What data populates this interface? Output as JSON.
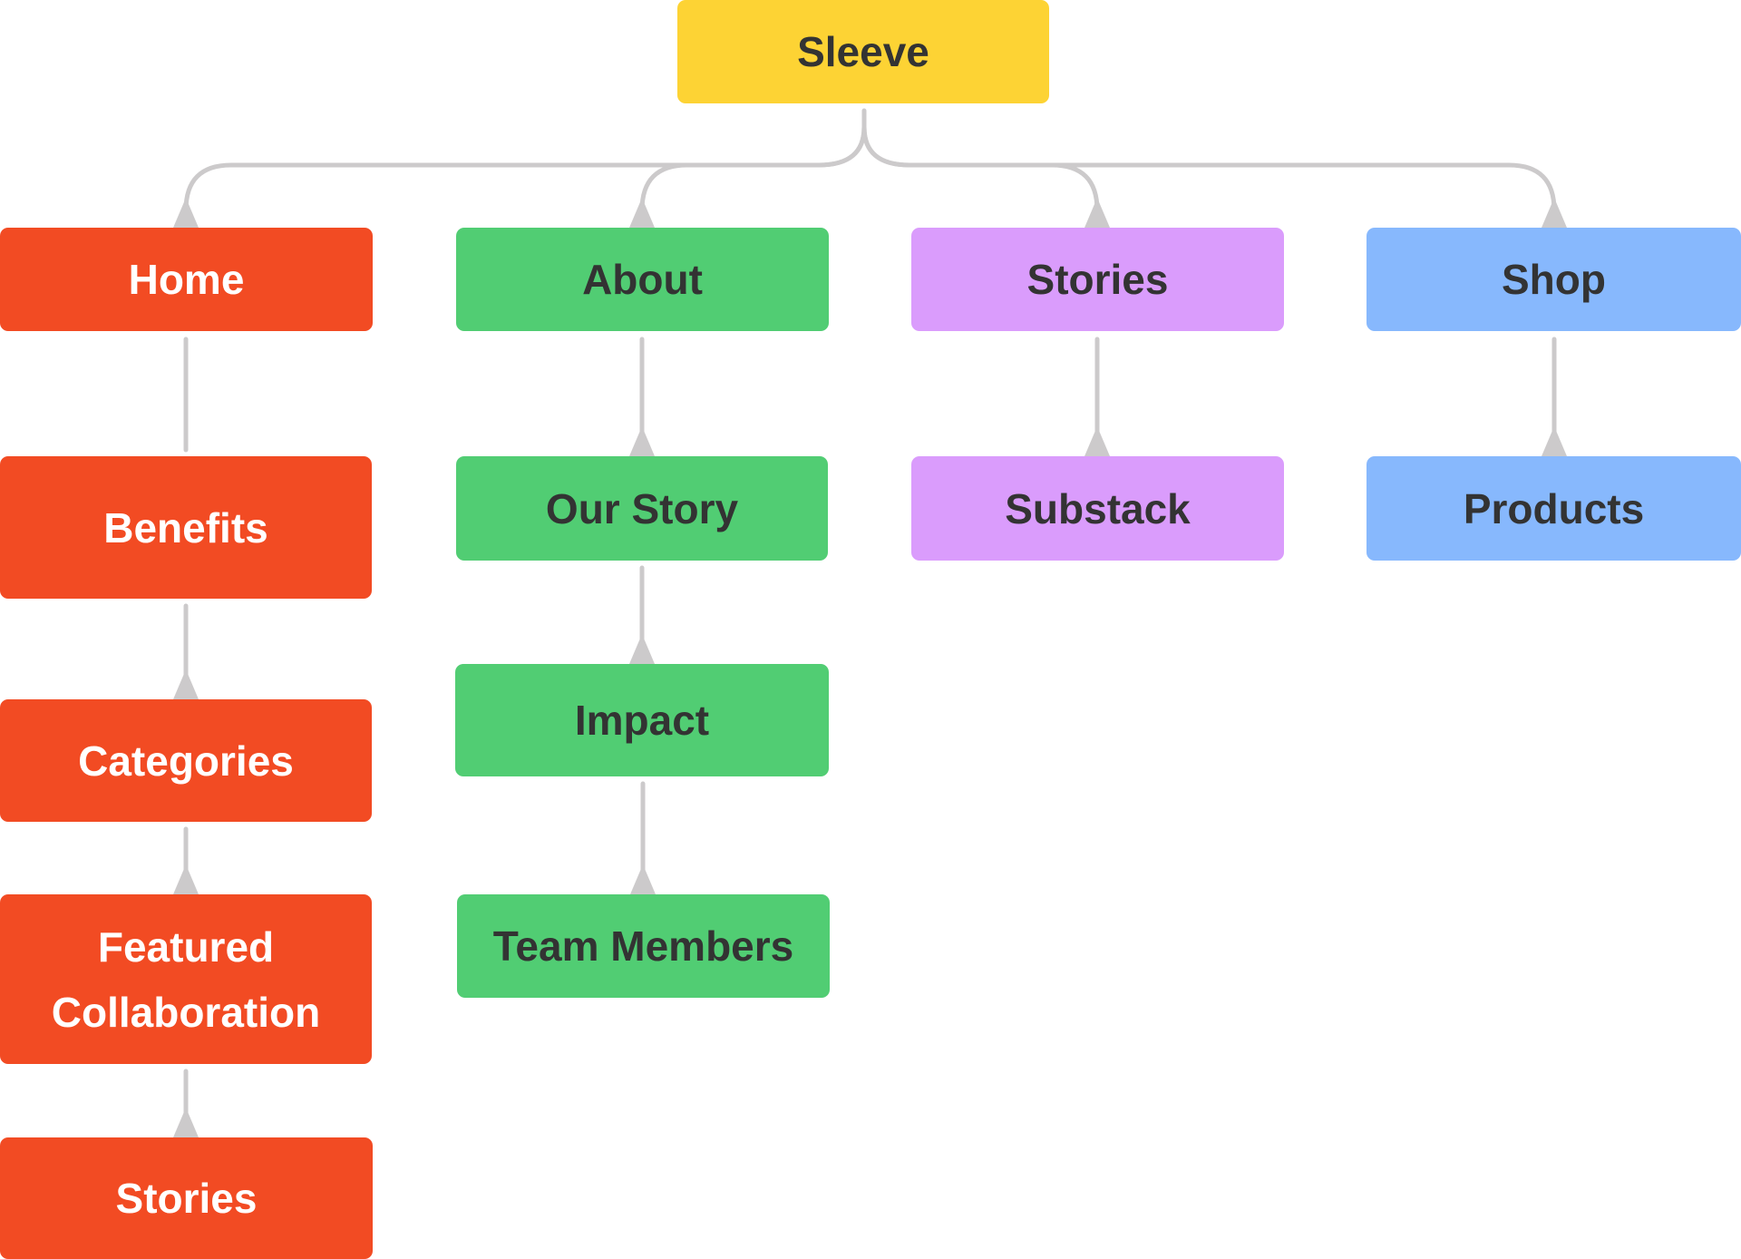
{
  "colors": {
    "root": "#FDD334",
    "home": "#F24B23",
    "about": "#51CD73",
    "stories": "#DA9CFC",
    "shop": "#87B8FD",
    "connector": "#CCCACB"
  },
  "root": {
    "label": "Sleeve"
  },
  "branches": [
    {
      "label": "Home",
      "children": [
        {
          "label": "Benefits"
        },
        {
          "label": "Categories"
        },
        {
          "label": "Featured Collaboration"
        },
        {
          "label": "Stories"
        }
      ]
    },
    {
      "label": "About",
      "children": [
        {
          "label": "Our Story"
        },
        {
          "label": "Impact"
        },
        {
          "label": "Team Members"
        }
      ]
    },
    {
      "label": "Stories",
      "children": [
        {
          "label": "Substack"
        }
      ]
    },
    {
      "label": "Shop",
      "children": [
        {
          "label": "Products"
        }
      ]
    }
  ]
}
